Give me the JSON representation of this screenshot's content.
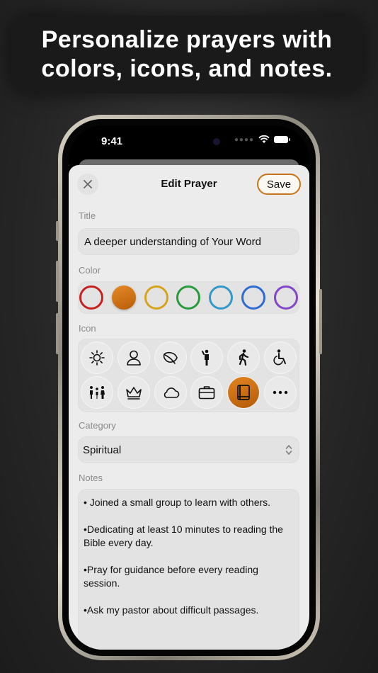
{
  "banner": {
    "text": "Personalize prayers with\ncolors, icons, and notes."
  },
  "status": {
    "time": "9:41"
  },
  "sheet": {
    "title": "Edit Prayer",
    "save_label": "Save",
    "title_label": "Title",
    "title_value": "A deeper understanding of Your Word",
    "color_label": "Color",
    "colors": [
      "#c62222",
      "#c8741a",
      "#d6a31d",
      "#2a9a3d",
      "#3498c9",
      "#2f6bd1",
      "#8446c9"
    ],
    "selected_color": "#c8741a",
    "icon_label": "Icon",
    "icons": [
      "sun-icon",
      "person-icon",
      "leaf-icon",
      "figure-stand-icon",
      "figure-walk-icon",
      "wheelchair-icon",
      "family-icon",
      "crown-icon",
      "cloud-icon",
      "briefcase-icon",
      "book-icon",
      "more-icon"
    ],
    "selected_icon": "book-icon",
    "category_label": "Category",
    "category_value": "Spiritual",
    "notes_label": "Notes",
    "notes": [
      "• Joined a small group to learn with others.",
      "•Dedicating at least 10 minutes to reading the Bible every day.",
      "•Pray for guidance before every reading session.",
      "•Ask my pastor about difficult passages."
    ]
  }
}
